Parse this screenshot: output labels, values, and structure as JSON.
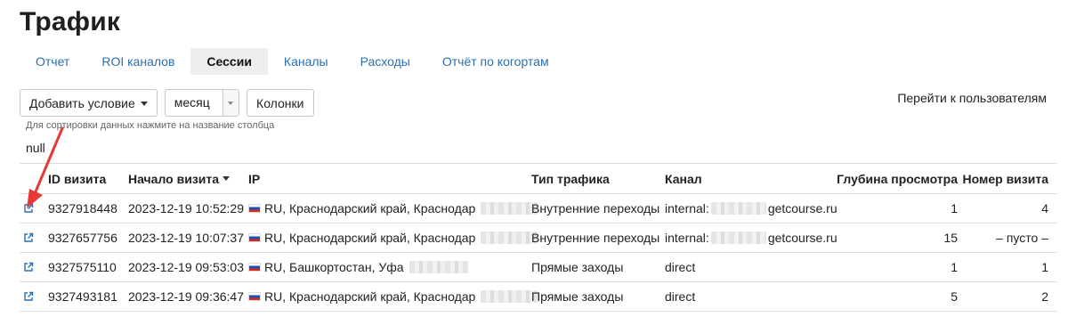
{
  "page": {
    "title": "Трафик"
  },
  "tabs": [
    {
      "label": "Отчет",
      "active": false
    },
    {
      "label": "ROI каналов",
      "active": false
    },
    {
      "label": "Сессии",
      "active": true
    },
    {
      "label": "Каналы",
      "active": false
    },
    {
      "label": "Расходы",
      "active": false
    },
    {
      "label": "Отчёт по когортам",
      "active": false
    }
  ],
  "toolbar": {
    "add_condition_label": "Добавить условие",
    "period_value": "месяц",
    "columns_label": "Колонки",
    "goto_users_label": "Перейти к пользователям"
  },
  "sort_hint": "Для сортировки данных нажмите на название столбца",
  "null_text": "null",
  "table": {
    "headers": {
      "id": "ID визита",
      "start": "Начало визита",
      "ip": "IP",
      "type": "Тип трафика",
      "channel": "Канал",
      "depth": "Глубина просмотра",
      "num": "Номер визита"
    },
    "rows": [
      {
        "id": "9327918448",
        "start": "2023-12-19 10:52:29",
        "ip": "RU, Краснодарский край, Краснодар",
        "type": "Внутренние переходы",
        "channel_prefix": "internal:",
        "channel_suffix": "getcourse.ru",
        "depth": "1",
        "num": "4"
      },
      {
        "id": "9327657756",
        "start": "2023-12-19 10:07:37",
        "ip": "RU, Краснодарский край, Краснодар",
        "type": "Внутренние переходы",
        "channel_prefix": "internal:",
        "channel_suffix": "getcourse.ru",
        "depth": "15",
        "num": "– пусто –"
      },
      {
        "id": "9327575110",
        "start": "2023-12-19 09:53:03",
        "ip": "RU, Башкортостан, Уфа",
        "type": "Прямые заходы",
        "channel_prefix": "direct",
        "channel_suffix": "",
        "depth": "1",
        "num": "1"
      },
      {
        "id": "9327493181",
        "start": "2023-12-19 09:36:47",
        "ip": "RU, Краснодарский край, Краснодар",
        "type": "Прямые заходы",
        "channel_prefix": "direct",
        "channel_suffix": "",
        "depth": "5",
        "num": "2"
      }
    ]
  },
  "colors": {
    "link": "#2a6fb0",
    "annotation_arrow": "#e53935",
    "row_border": "#dddddd"
  },
  "icons": {
    "row_link": "external-link-icon",
    "flag": "russia-flag-icon"
  }
}
